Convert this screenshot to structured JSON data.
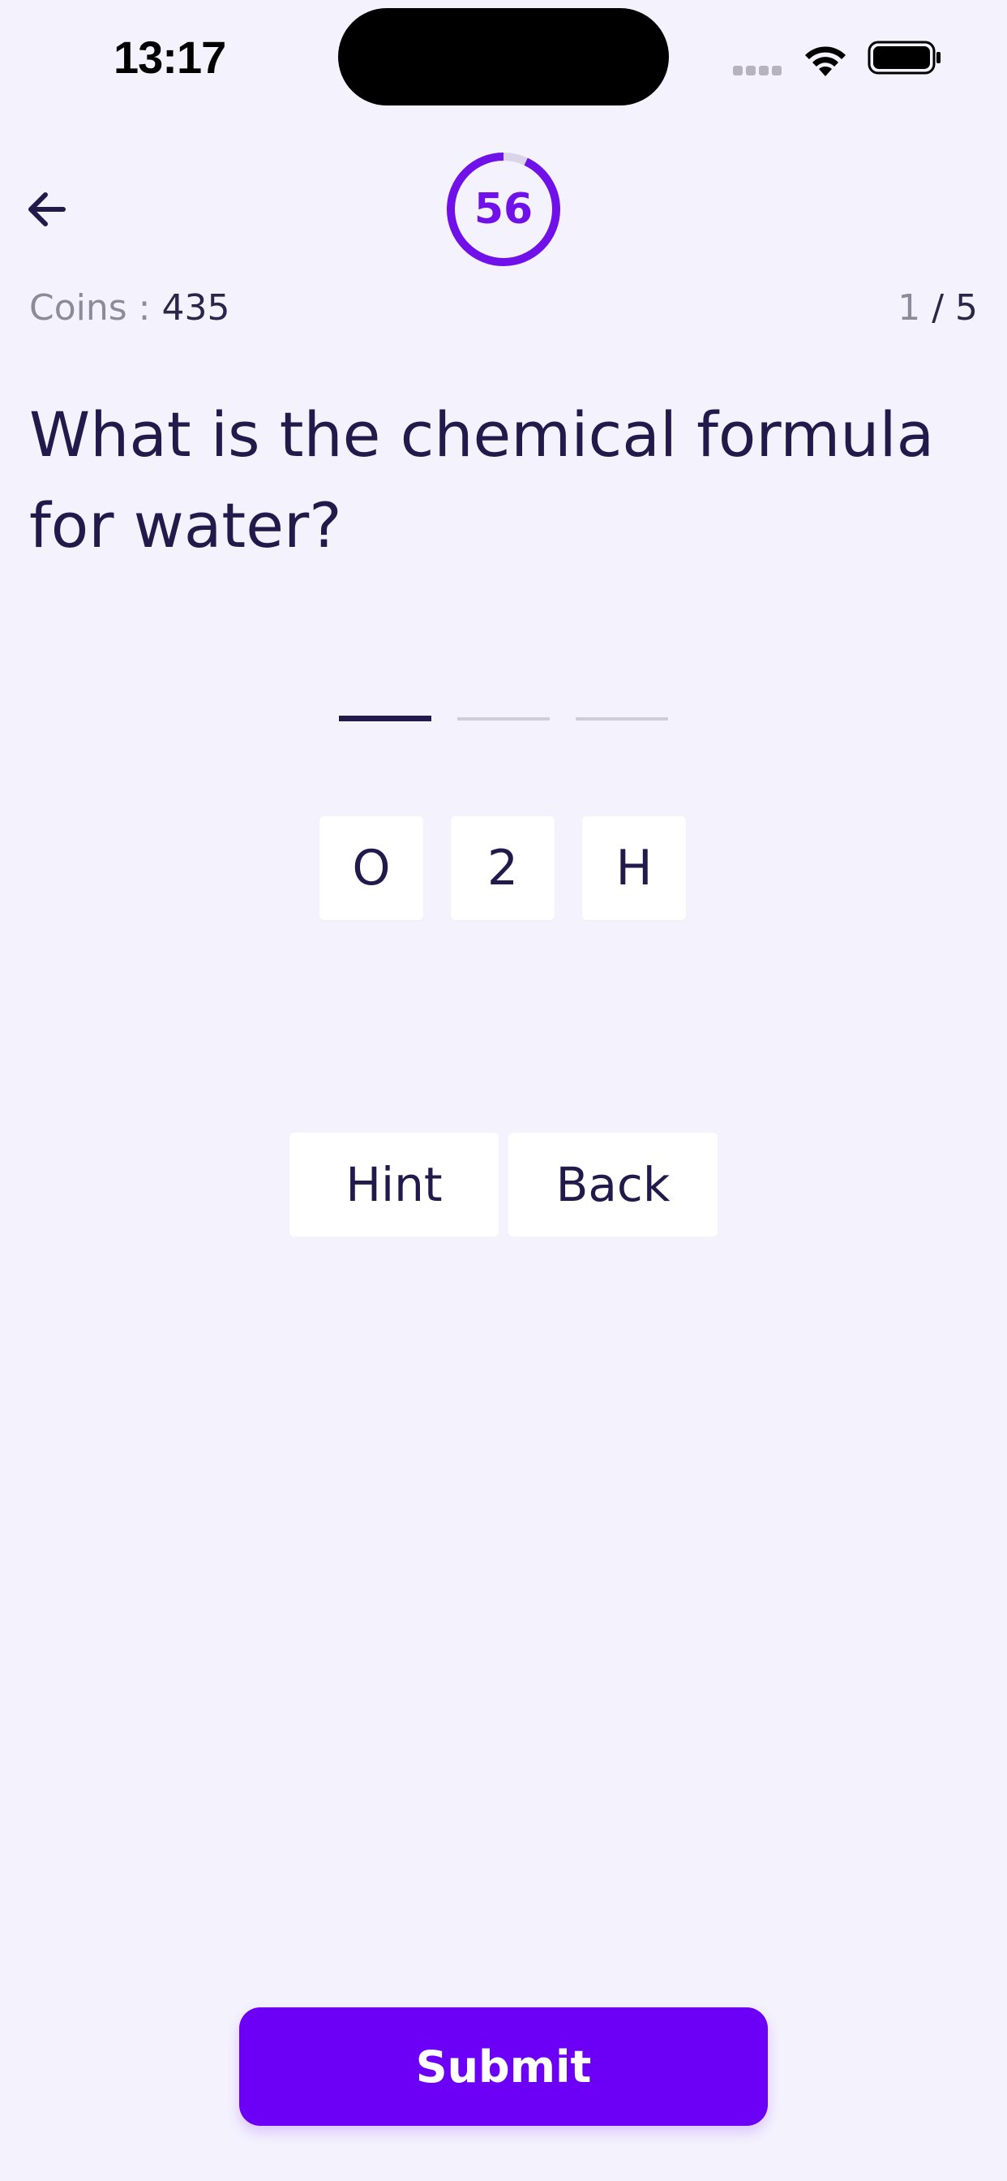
{
  "status_bar": {
    "time": "13:17"
  },
  "header": {
    "timer_value": "56",
    "timer_fraction_remaining": 0.93,
    "coins_label": "Coins : ",
    "coins_value": "435",
    "progress_current": "1",
    "progress_separator": " / ",
    "progress_total": "5"
  },
  "question": {
    "text": "What is the chemical formula for water?"
  },
  "answer": {
    "slot_count": 3,
    "active_slot": 0
  },
  "letters": [
    "O",
    "2",
    "H"
  ],
  "actions": {
    "hint_label": "Hint",
    "back_label": "Back"
  },
  "submit_label": "Submit",
  "colors": {
    "accent": "#6C00F6",
    "text": "#221A4A",
    "background": "#F4F2FD",
    "muted": "#8D8A99"
  },
  "icons": {
    "back": "arrow-left-icon",
    "wifi": "wifi-icon",
    "battery": "battery-icon",
    "signal": "signal-icon"
  }
}
